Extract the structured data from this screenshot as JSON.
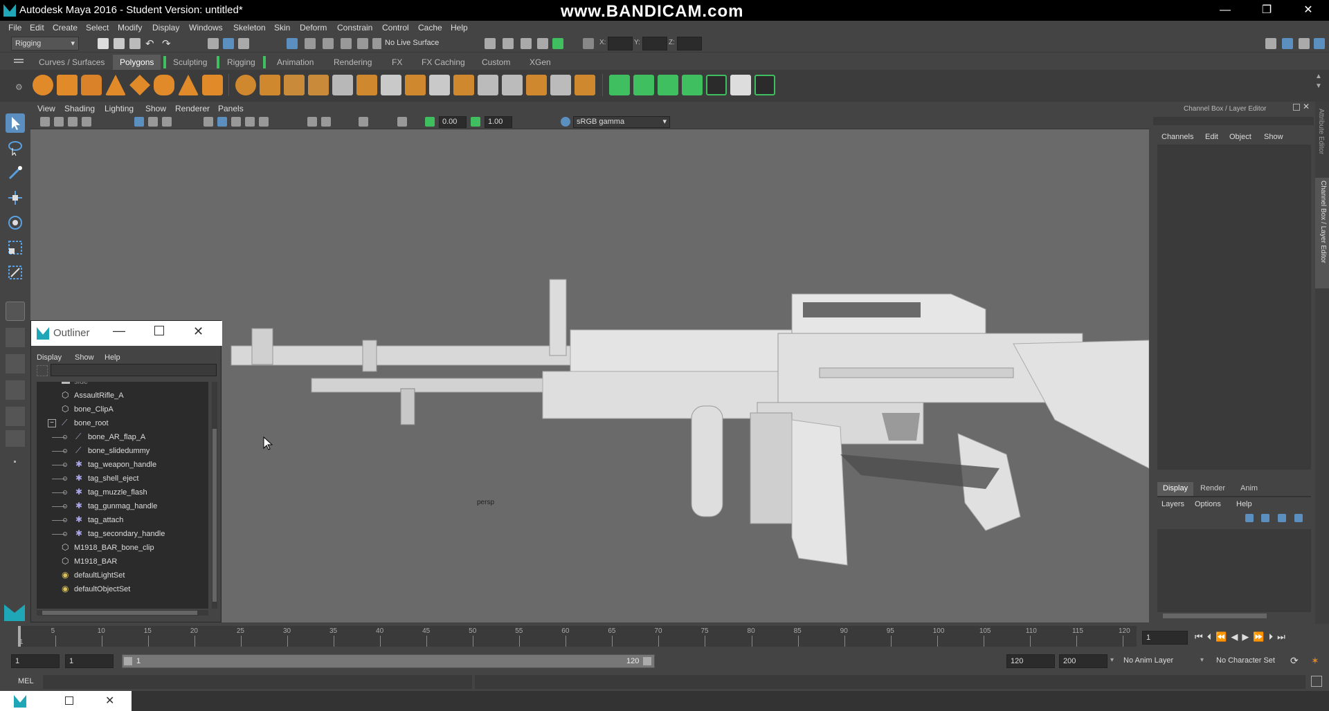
{
  "title_bar": {
    "title": "Autodesk Maya 2016 - Student Version: untitled*",
    "watermark": "www.BANDICAM.com",
    "minimize": "—",
    "restore": "❐",
    "close": "✕"
  },
  "menu_bar": [
    "File",
    "Edit",
    "Create",
    "Select",
    "Modify",
    "Display",
    "Windows",
    "Skeleton",
    "Skin",
    "Deform",
    "Constrain",
    "Control",
    "Cache",
    "Help"
  ],
  "status_line": {
    "menuset": "Rigging",
    "live_surface": "No Live Surface",
    "x_label": "X:",
    "y_label": "Y:",
    "z_label": "Z:"
  },
  "shelf_tabs": [
    "Curves / Surfaces",
    "Polygons",
    "Sculpting",
    "Rigging",
    "Animation",
    "Rendering",
    "FX",
    "FX Caching",
    "Custom",
    "XGen"
  ],
  "active_shelf": "Polygons",
  "panel_menu": [
    "View",
    "Shading",
    "Lighting",
    "Show",
    "Renderer",
    "Panels"
  ],
  "panel_toolbar": {
    "field1": "0.00",
    "field2": "1.00",
    "color_space": "sRGB gamma"
  },
  "viewport": {
    "camera_label": "persp"
  },
  "outliner": {
    "title": "Outliner",
    "menu": [
      "Display",
      "Show",
      "Help"
    ],
    "items": [
      {
        "label": "side",
        "icon": "camera-icon",
        "indent": 2,
        "dim": true
      },
      {
        "label": "AssaultRifle_A",
        "icon": "mesh-icon",
        "indent": 2
      },
      {
        "label": "bone_ClipA",
        "icon": "mesh-icon",
        "indent": 2
      },
      {
        "label": "bone_root",
        "icon": "joint-icon",
        "indent": 2,
        "expander": "−"
      },
      {
        "label": "bone_AR_flap_A",
        "icon": "joint-icon",
        "indent": 3
      },
      {
        "label": "bone_slidedummy",
        "icon": "joint-icon",
        "indent": 3
      },
      {
        "label": "tag_weapon_handle",
        "icon": "locator-icon",
        "indent": 3
      },
      {
        "label": "tag_shell_eject",
        "icon": "locator-icon",
        "indent": 3
      },
      {
        "label": "tag_muzzle_flash",
        "icon": "locator-icon",
        "indent": 3
      },
      {
        "label": "tag_gunmag_handle",
        "icon": "locator-icon",
        "indent": 3
      },
      {
        "label": "tag_attach",
        "icon": "locator-icon",
        "indent": 3
      },
      {
        "label": "tag_secondary_handle",
        "icon": "locator-icon",
        "indent": 3
      },
      {
        "label": "M1918_BAR_bone_clip",
        "icon": "mesh-icon",
        "indent": 2
      },
      {
        "label": "M1918_BAR",
        "icon": "mesh-icon",
        "indent": 2
      },
      {
        "label": "defaultLightSet",
        "icon": "set-icon",
        "indent": 2
      },
      {
        "label": "defaultObjectSet",
        "icon": "set-icon",
        "indent": 2
      }
    ]
  },
  "channel_box": {
    "title": "Channel Box / Layer Editor",
    "menu": [
      "Channels",
      "Edit",
      "Object",
      "Show"
    ],
    "layer_tabs": [
      "Display",
      "Render",
      "Anim"
    ],
    "layer_menu": [
      "Layers",
      "Options",
      "Help"
    ],
    "side_tabs": [
      "Attribute Editor",
      "Channel Box / Layer Editor"
    ]
  },
  "timeline": {
    "ticks": [
      "5",
      "10",
      "15",
      "20",
      "25",
      "30",
      "35",
      "40",
      "45",
      "50",
      "55",
      "60",
      "65",
      "70",
      "75",
      "80",
      "85",
      "90",
      "95",
      "100",
      "105",
      "110",
      "115",
      "120"
    ],
    "start_label": "1",
    "current_frame": "1"
  },
  "range_slider": {
    "start": "1",
    "playback_start": "1",
    "inner_start": "1",
    "inner_end": "120",
    "playback_end": "120",
    "end": "200",
    "anim_layer": "No Anim Layer",
    "character_set": "No Character Set"
  },
  "command_line": {
    "label": "MEL"
  },
  "colors": {
    "accent_green": "#3fbf5f",
    "shelf_orange": "#e08a2a",
    "viewport_bg": "#6a6a6a",
    "active_tab": "#5a5a5a"
  }
}
